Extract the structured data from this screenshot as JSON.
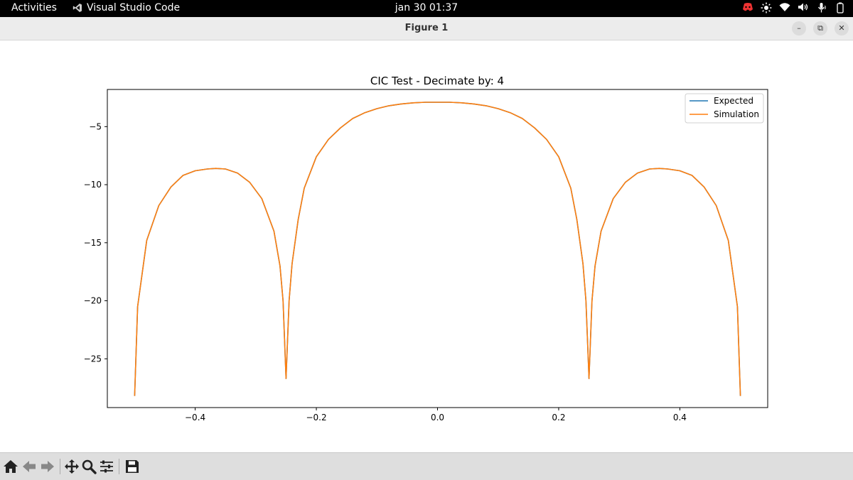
{
  "topbar": {
    "activities": "Activities",
    "app_name": "Visual Studio Code",
    "clock": "jan 30  01:37"
  },
  "window": {
    "title": "Figure 1"
  },
  "chart_data": {
    "type": "line",
    "title": "CIC Test - Decimate by: 4",
    "xlabel": "",
    "ylabel": "",
    "xlim": [
      -0.545,
      0.545
    ],
    "ylim": [
      -29.2,
      -1.8
    ],
    "xticks": [
      -0.4,
      -0.2,
      0.0,
      0.2,
      0.4
    ],
    "xtick_labels": [
      "−0.4",
      "−0.2",
      "0.0",
      "0.2",
      "0.4"
    ],
    "yticks": [
      -5,
      -10,
      -15,
      -20,
      -25
    ],
    "ytick_labels": [
      "−5",
      "−10",
      "−15",
      "−20",
      "−25"
    ],
    "legend_position": "top-right",
    "grid": false,
    "series": [
      {
        "name": "Expected",
        "color": "#1f77b4",
        "x": [
          -0.5,
          -0.495,
          -0.48,
          -0.46,
          -0.44,
          -0.42,
          -0.4,
          -0.38,
          -0.366,
          -0.35,
          -0.33,
          -0.31,
          -0.29,
          -0.27,
          -0.26,
          -0.255,
          -0.25,
          -0.245,
          -0.24,
          -0.23,
          -0.22,
          -0.2,
          -0.18,
          -0.16,
          -0.14,
          -0.12,
          -0.1,
          -0.08,
          -0.06,
          -0.04,
          -0.02,
          0.0,
          0.02,
          0.04,
          0.06,
          0.08,
          0.1,
          0.12,
          0.14,
          0.16,
          0.18,
          0.2,
          0.22,
          0.23,
          0.24,
          0.245,
          0.25,
          0.255,
          0.26,
          0.27,
          0.29,
          0.31,
          0.33,
          0.35,
          0.366,
          0.38,
          0.4,
          0.42,
          0.44,
          0.46,
          0.48,
          0.495,
          0.5
        ],
        "y": [
          -28.2,
          -20.5,
          -14.8,
          -11.8,
          -10.2,
          -9.2,
          -8.8,
          -8.65,
          -8.6,
          -8.65,
          -9.0,
          -9.8,
          -11.2,
          -14.0,
          -17.0,
          -20.0,
          -26.7,
          -20.0,
          -16.8,
          -13.0,
          -10.3,
          -7.6,
          -6.1,
          -5.1,
          -4.3,
          -3.8,
          -3.45,
          -3.2,
          -3.05,
          -2.95,
          -2.9,
          -2.9,
          -2.9,
          -2.95,
          -3.05,
          -3.2,
          -3.45,
          -3.8,
          -4.3,
          -5.1,
          -6.1,
          -7.6,
          -10.3,
          -13.0,
          -16.8,
          -20.0,
          -26.7,
          -20.0,
          -17.0,
          -14.0,
          -11.2,
          -9.8,
          -9.0,
          -8.65,
          -8.6,
          -8.65,
          -8.8,
          -9.2,
          -10.2,
          -11.8,
          -14.8,
          -20.5,
          -28.2
        ]
      },
      {
        "name": "Simulation",
        "color": "#ff7f0e",
        "x": [
          -0.5,
          -0.495,
          -0.48,
          -0.46,
          -0.44,
          -0.42,
          -0.4,
          -0.38,
          -0.366,
          -0.35,
          -0.33,
          -0.31,
          -0.29,
          -0.27,
          -0.26,
          -0.255,
          -0.25,
          -0.245,
          -0.24,
          -0.23,
          -0.22,
          -0.2,
          -0.18,
          -0.16,
          -0.14,
          -0.12,
          -0.1,
          -0.08,
          -0.06,
          -0.04,
          -0.02,
          0.0,
          0.02,
          0.04,
          0.06,
          0.08,
          0.1,
          0.12,
          0.14,
          0.16,
          0.18,
          0.2,
          0.22,
          0.23,
          0.24,
          0.245,
          0.25,
          0.255,
          0.26,
          0.27,
          0.29,
          0.31,
          0.33,
          0.35,
          0.366,
          0.38,
          0.4,
          0.42,
          0.44,
          0.46,
          0.48,
          0.495,
          0.5
        ],
        "y": [
          -28.2,
          -20.5,
          -14.8,
          -11.8,
          -10.2,
          -9.2,
          -8.8,
          -8.65,
          -8.6,
          -8.65,
          -9.0,
          -9.8,
          -11.2,
          -14.0,
          -17.0,
          -20.0,
          -26.7,
          -20.0,
          -16.8,
          -13.0,
          -10.3,
          -7.6,
          -6.1,
          -5.1,
          -4.3,
          -3.8,
          -3.45,
          -3.2,
          -3.05,
          -2.95,
          -2.9,
          -2.9,
          -2.9,
          -2.95,
          -3.05,
          -3.2,
          -3.45,
          -3.8,
          -4.3,
          -5.1,
          -6.1,
          -7.6,
          -10.3,
          -13.0,
          -16.8,
          -20.0,
          -26.7,
          -20.0,
          -17.0,
          -14.0,
          -11.2,
          -9.8,
          -9.0,
          -8.65,
          -8.6,
          -8.65,
          -8.8,
          -9.2,
          -10.2,
          -11.8,
          -14.8,
          -20.5,
          -28.2
        ]
      }
    ]
  },
  "toolbar": {
    "buttons": [
      "home-icon",
      "back-icon",
      "forward-icon",
      "pan-icon",
      "zoom-icon",
      "configure-subplots-icon",
      "save-icon"
    ]
  }
}
